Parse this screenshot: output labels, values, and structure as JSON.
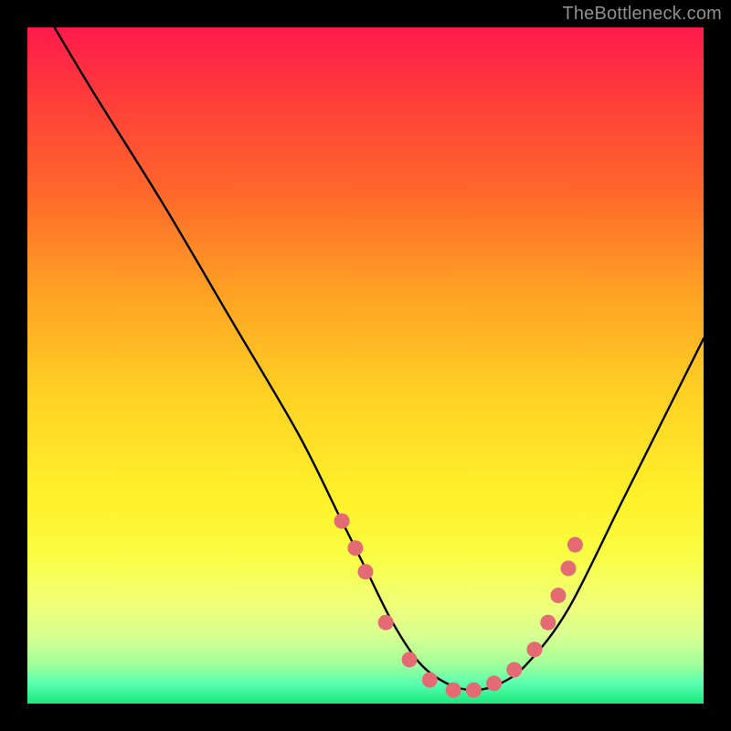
{
  "watermark": "TheBottleneck.com",
  "chart_data": {
    "type": "line",
    "title": "",
    "xlabel": "",
    "ylabel": "",
    "xlim": [
      0,
      100
    ],
    "ylim": [
      0,
      100
    ],
    "series": [
      {
        "name": "curve",
        "x": [
          4,
          10,
          20,
          30,
          40,
          46,
          50,
          54,
          58,
          62,
          66,
          70,
          74,
          80,
          88,
          96,
          100
        ],
        "y": [
          100,
          90,
          74,
          57,
          40,
          28,
          20,
          12,
          6,
          3,
          2,
          3,
          6,
          14,
          30,
          46,
          54
        ]
      }
    ],
    "markers": {
      "name": "dots",
      "color": "#e46a74",
      "x": [
        46.5,
        48.5,
        50.0,
        53.0,
        56.5,
        59.5,
        63.0,
        66.0,
        69.0,
        72.0,
        75.0,
        77.0,
        78.5,
        80.0,
        81.0
      ],
      "y": [
        27.0,
        23.0,
        19.5,
        12.0,
        6.5,
        3.5,
        2.0,
        2.0,
        3.0,
        5.0,
        8.0,
        12.0,
        16.0,
        20.0,
        23.5
      ]
    }
  }
}
